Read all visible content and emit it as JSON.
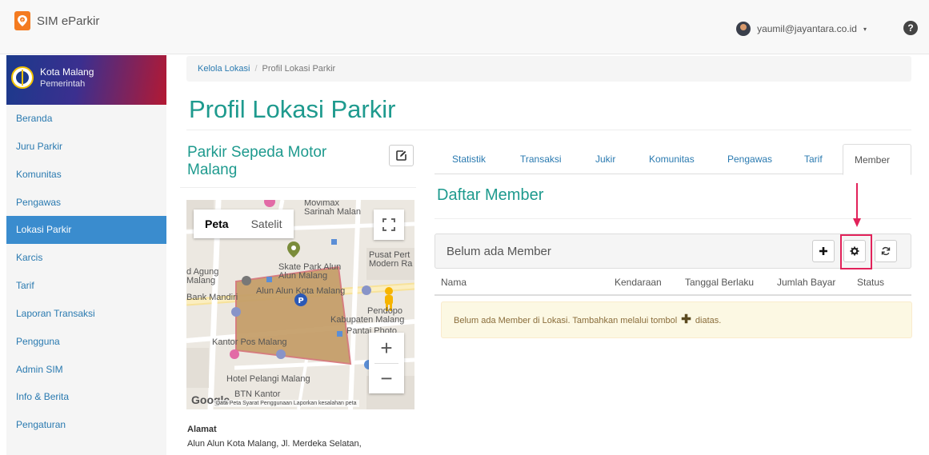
{
  "app": {
    "title": "SIM eParkir",
    "user_email": "yaumil@jayantara.co.id",
    "help_glyph": "?",
    "caret_glyph": "▾",
    "colors": {
      "accent": "#1e9a8e",
      "link": "#2a7ab0",
      "active_menu": "#3a8cce",
      "highlight": "#e2225a"
    }
  },
  "sidebar": {
    "org_name": "Kota Malang",
    "org_type": "Pemerintah",
    "items": [
      {
        "label": "Beranda"
      },
      {
        "label": "Juru Parkir"
      },
      {
        "label": "Komunitas"
      },
      {
        "label": "Pengawas"
      },
      {
        "label": "Lokasi Parkir",
        "active": true
      },
      {
        "label": "Karcis"
      },
      {
        "label": "Tarif"
      },
      {
        "label": "Laporan Transaksi"
      },
      {
        "label": "Pengguna"
      },
      {
        "label": "Admin SIM"
      },
      {
        "label": "Info & Berita"
      },
      {
        "label": "Pengaturan"
      }
    ]
  },
  "breadcrumb": {
    "parent": "Kelola Lokasi",
    "separator": "/",
    "current": "Profil Lokasi Parkir"
  },
  "page": {
    "title": "Profil Lokasi Parkir"
  },
  "location": {
    "name": "Parkir Sepeda Motor Malang",
    "address_label": "Alamat",
    "address": "Alun Alun Kota Malang, Jl. Merdeka Selatan,"
  },
  "map": {
    "type_map": "Peta",
    "type_satellite": "Satelit",
    "zoom_in": "+",
    "zoom_out": "−",
    "google": "Google",
    "attribution": "Data Peta    Syarat Penggunaan    Laporkan kesalahan peta",
    "labels": {
      "movimax": "Movimax",
      "sarinah": "Sarinah Malan",
      "skatepark": "Skate Park Alun",
      "alunmalang": "Alun Malang",
      "agung": "d Agung",
      "malang": "Malang",
      "pusat": "Pusat Pert",
      "modern": "Modern Ra",
      "bankmandiri": "Bank Mandiri",
      "alunkota": "Alun Alun Kota Malang",
      "pendopo": "Pendopo",
      "kabupaten": "Kabupaten Malang",
      "pantai": "Pantai Photo",
      "kantorpos": "Kantor Pos Malang",
      "pelangi": "Hotel Pelangi Malang",
      "btn": "BTN Kantor"
    }
  },
  "tabs": [
    {
      "label": "Statistik"
    },
    {
      "label": "Transaksi"
    },
    {
      "label": "Jukir"
    },
    {
      "label": "Komunitas"
    },
    {
      "label": "Pengawas"
    },
    {
      "label": "Tarif"
    },
    {
      "label": "Member",
      "active": true
    }
  ],
  "members": {
    "title": "Daftar Member",
    "panel_title": "Belum ada Member",
    "columns": [
      "Nama",
      "Kendaraan",
      "Tanggal Berlaku",
      "Jumlah Bayar",
      "Status"
    ],
    "empty_message_before": "Belum ada Member di Lokasi. Tambahkan melalui tombol",
    "empty_message_after": "diatas.",
    "plus_glyph": "✚"
  }
}
